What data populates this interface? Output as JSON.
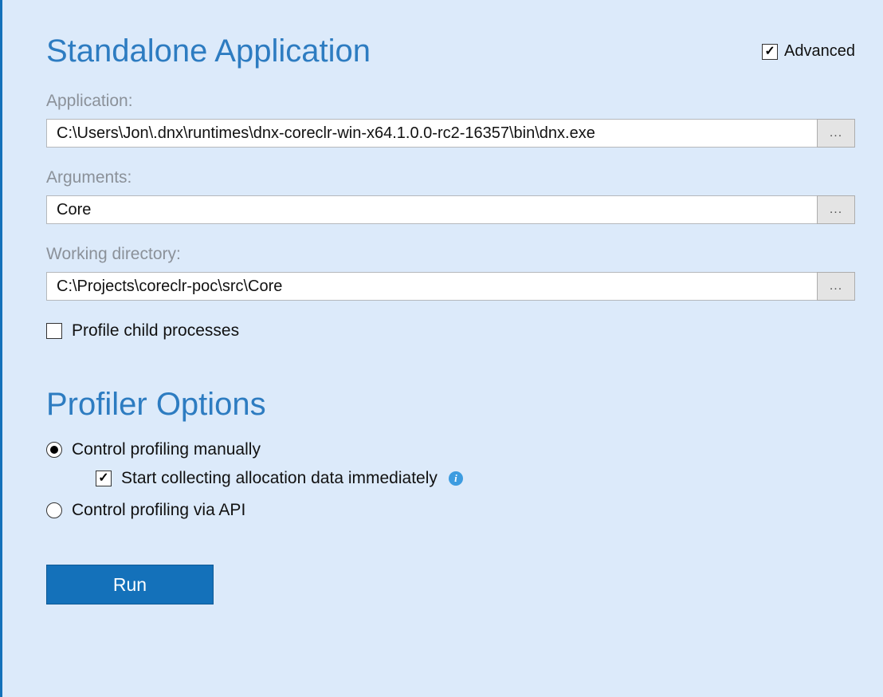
{
  "header": {
    "title": "Standalone Application",
    "advanced_label": "Advanced",
    "advanced_checked": true
  },
  "fields": {
    "application": {
      "label": "Application:",
      "value": "C:\\Users\\Jon\\.dnx\\runtimes\\dnx-coreclr-win-x64.1.0.0-rc2-16357\\bin\\dnx.exe",
      "browse": "..."
    },
    "arguments": {
      "label": "Arguments:",
      "value": "Core",
      "browse": "..."
    },
    "workdir": {
      "label": "Working directory:",
      "value": "C:\\Projects\\coreclr-poc\\src\\Core",
      "browse": "..."
    }
  },
  "profile_child": {
    "label": "Profile child processes",
    "checked": false
  },
  "profiler": {
    "title": "Profiler Options",
    "manual": {
      "label": "Control profiling manually",
      "selected": true
    },
    "start_collecting": {
      "label": "Start collecting allocation data immediately",
      "checked": true
    },
    "via_api": {
      "label": "Control profiling via API",
      "selected": false
    }
  },
  "run_label": "Run"
}
